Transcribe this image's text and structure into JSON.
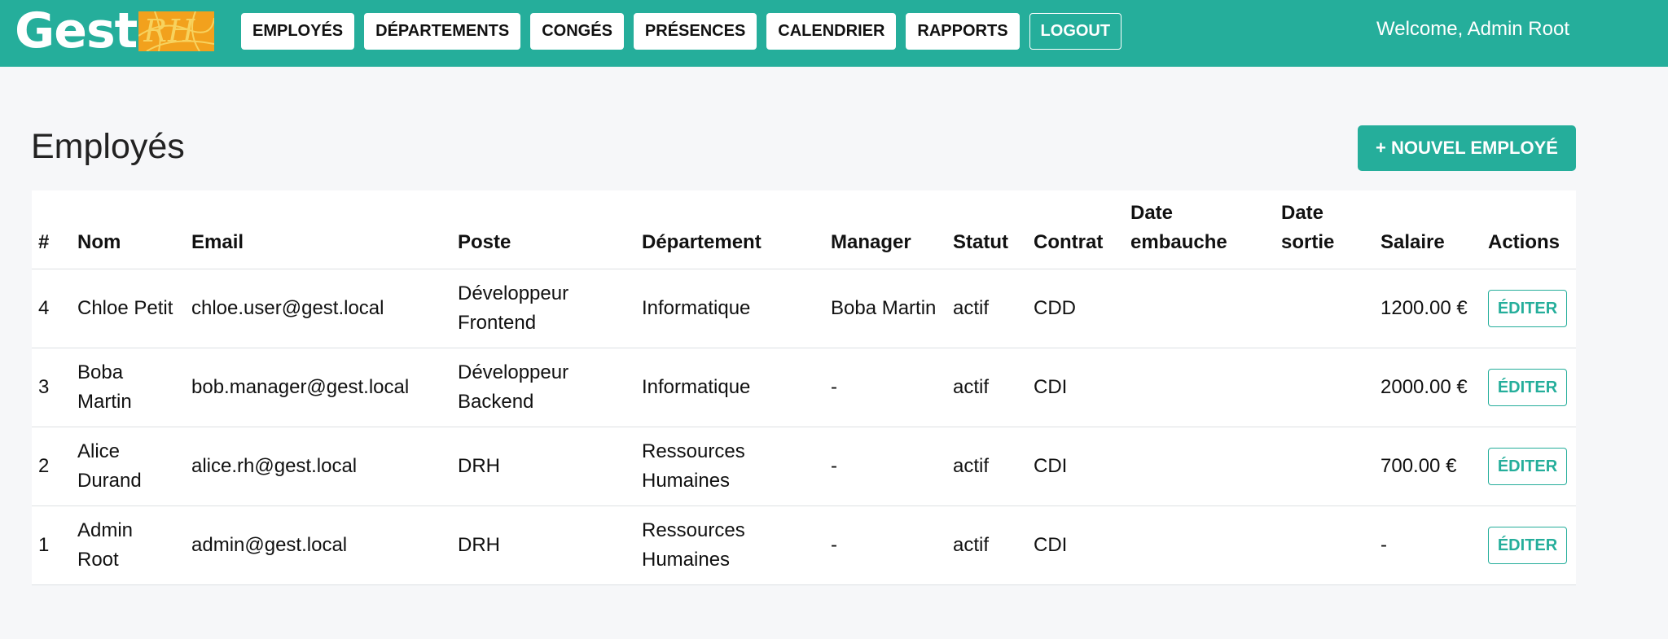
{
  "app": {
    "logo_text": "Gest",
    "logo_mark_text": "RH",
    "welcome": "Welcome, Admin Root"
  },
  "nav": {
    "items": [
      {
        "label": "EMPLOYÉS"
      },
      {
        "label": "DÉPARTEMENTS"
      },
      {
        "label": "CONGÉS"
      },
      {
        "label": "PRÉSENCES"
      },
      {
        "label": "CALENDRIER"
      },
      {
        "label": "RAPPORTS"
      }
    ],
    "logout_label": "LOGOUT"
  },
  "main": {
    "title": "Employés",
    "new_button_label": "+ NOUVEL EMPLOYÉ"
  },
  "table": {
    "headers": [
      "#",
      "Nom",
      "Email",
      "Poste",
      "Département",
      "Manager",
      "Statut",
      "Contrat",
      "Date embauche",
      "Date sortie",
      "Salaire",
      "Actions"
    ],
    "rows": [
      {
        "id": "4",
        "nom": "Chloe Petit",
        "email": "chloe.user@gest.local",
        "poste": "Développeur Frontend",
        "departement": "Informatique",
        "manager": "Boba Martin",
        "statut": "actif",
        "contrat": "CDD",
        "date_embauche": "",
        "date_sortie": "",
        "salaire": "1200.00 €",
        "action": "ÉDITER"
      },
      {
        "id": "3",
        "nom": "Boba Martin",
        "email": "bob.manager@gest.local",
        "poste": "Développeur Backend",
        "departement": "Informatique",
        "manager": "-",
        "statut": "actif",
        "contrat": "CDI",
        "date_embauche": "",
        "date_sortie": "",
        "salaire": "2000.00 €",
        "action": "ÉDITER"
      },
      {
        "id": "2",
        "nom": "Alice Durand",
        "email": "alice.rh@gest.local",
        "poste": "DRH",
        "departement": "Ressources Humaines",
        "manager": "-",
        "statut": "actif",
        "contrat": "CDI",
        "date_embauche": "",
        "date_sortie": "",
        "salaire": "700.00 €",
        "action": "ÉDITER"
      },
      {
        "id": "1",
        "nom": "Admin Root",
        "email": "admin@gest.local",
        "poste": "DRH",
        "departement": "Ressources Humaines",
        "manager": "-",
        "statut": "actif",
        "contrat": "CDI",
        "date_embauche": "",
        "date_sortie": "",
        "salaire": "-",
        "action": "ÉDITER"
      }
    ]
  },
  "colors": {
    "accent": "#25ae9b",
    "logo_mark": "#f2a11d",
    "background": "#f6f7f9"
  }
}
